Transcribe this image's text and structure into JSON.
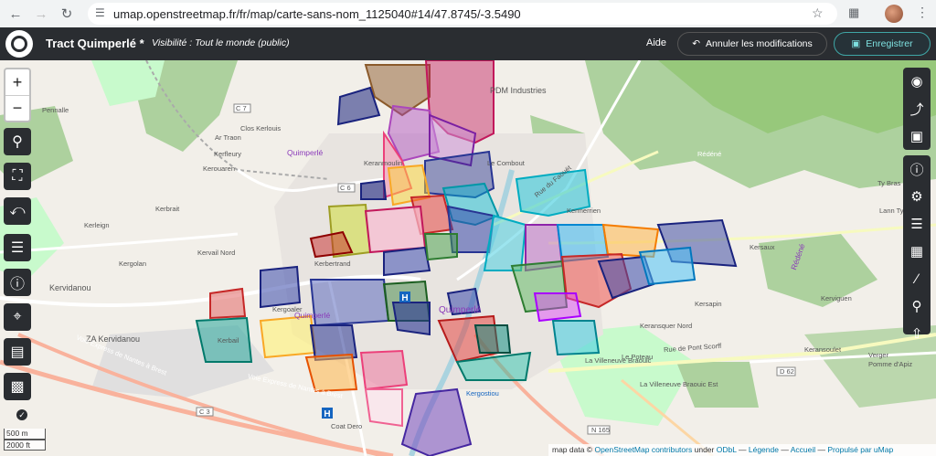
{
  "browser": {
    "url": "umap.openstreetmap.fr/fr/map/carte-sans-nom_1125040#14/47.8745/-3.5490",
    "back_icon": "arrow-left-icon",
    "forward_icon": "arrow-right-icon",
    "reload_icon": "reload-icon"
  },
  "header": {
    "title": "Tract Quimperlé *",
    "visibility": "Visibilité : Tout le monde (public)",
    "help": "Aide",
    "cancel_label": "Annuler les modifications",
    "save_label": "Enregistrer",
    "accent": "#7ee0e0"
  },
  "controls": {
    "zoom_in": "+",
    "zoom_out": "−"
  },
  "scale": {
    "metric": "500 m",
    "imperial": "2000 ft"
  },
  "attribution": {
    "prefix": "map data ©",
    "osm": "OpenStreetMap contributors",
    "under": "under",
    "license": "ODbL",
    "legend": "Légende",
    "home": "Accueil",
    "powered": "Propulsé par uMap"
  },
  "map_labels": {
    "quimperle_1": "Quimperlé",
    "quimperle_2": "Quimperlé",
    "quimperle_center": "Quimperlé",
    "pdm": "PDM Industries",
    "kervidanou": "Kervidanou",
    "za_kervidanou": "ZA Kervidanou",
    "kergoaler": "Kergoaler",
    "redene": "Rédéné",
    "rue_pont_scorff": "Rue de Pont Scorff",
    "villeneuve_braouic": "La Villeneuve Braouic",
    "villeneuve_est": "La Villeneuve Braouic Est",
    "coat_dero": "Coat Dero",
    "kergostiou": "Kergostiou",
    "voie_express_1": "Voie Express de Nantes à Brest",
    "voie_express_2": "Voie Express de Nantes à Brest",
    "rue_faouet": "Rue du Faouët",
    "c7": "C 7",
    "c6": "C 6",
    "c3": "C 3",
    "d62": "D 62",
    "n165": "N 165",
    "kersaux": "Kersaux",
    "kerfleury": "Kerfleury",
    "kerbrait": "Kerbrait",
    "kerleign": "Kerleign",
    "kervail": "Kervail Nord",
    "kerbertrand": "Kerbertrand",
    "kergolan": "Kergolan",
    "kerbail": "Kerbail",
    "kersapin": "Kersapin",
    "keranquer": "Keransquer Nord",
    "kerviguen": "Kerviguen",
    "kerantrou": "Keransoulet",
    "le_poteau": "Le Poteau",
    "ty_bras": "Ty Bras",
    "lann": "Lann Ty",
    "verger": "Verger",
    "pomme": "Pomme d'Apiz",
    "clos_kerlouis": "Clos Kerlouis",
    "ar_traon": "Ar Traon",
    "keranmoulin": "Keranmoulin",
    "le_combout": "Le Combout",
    "kermerrien": "Kermerrien",
    "pennalle": "Pennalle",
    "kerouaren": "Kerouaren"
  }
}
